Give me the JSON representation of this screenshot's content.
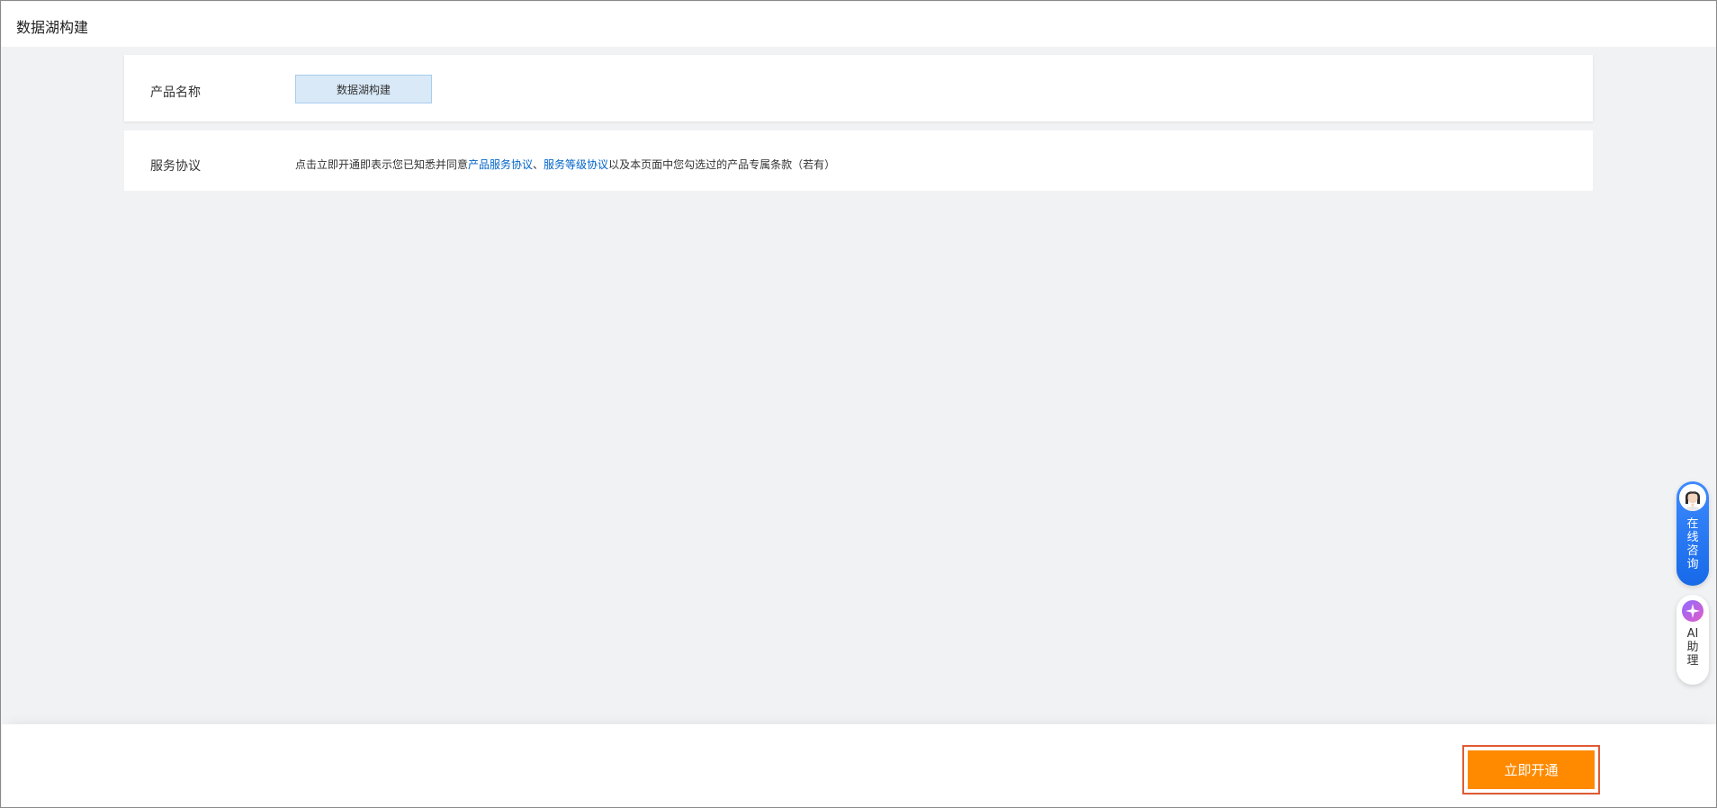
{
  "header": {
    "title": "数据湖构建"
  },
  "product": {
    "label": "产品名称",
    "value": "数据湖构建"
  },
  "agreement": {
    "label": "服务协议",
    "prefix": "点击立即开通即表示您已知悉并同意",
    "link1": "产品服务协议",
    "separator": "、",
    "link2": "服务等级协议",
    "suffix": "以及本页面中您勾选过的产品专属条款（若有）"
  },
  "footer": {
    "open_button_label": "立即开通"
  },
  "widgets": {
    "consult_chars": [
      "在",
      "线",
      "咨",
      "询"
    ],
    "ai_chars": [
      "AI",
      "助",
      "理"
    ]
  },
  "colors": {
    "accent_orange": "#ff8a00",
    "highlight_red": "#e05a33",
    "link_blue": "#0064c8",
    "chip_bg": "#d9e9f7"
  }
}
